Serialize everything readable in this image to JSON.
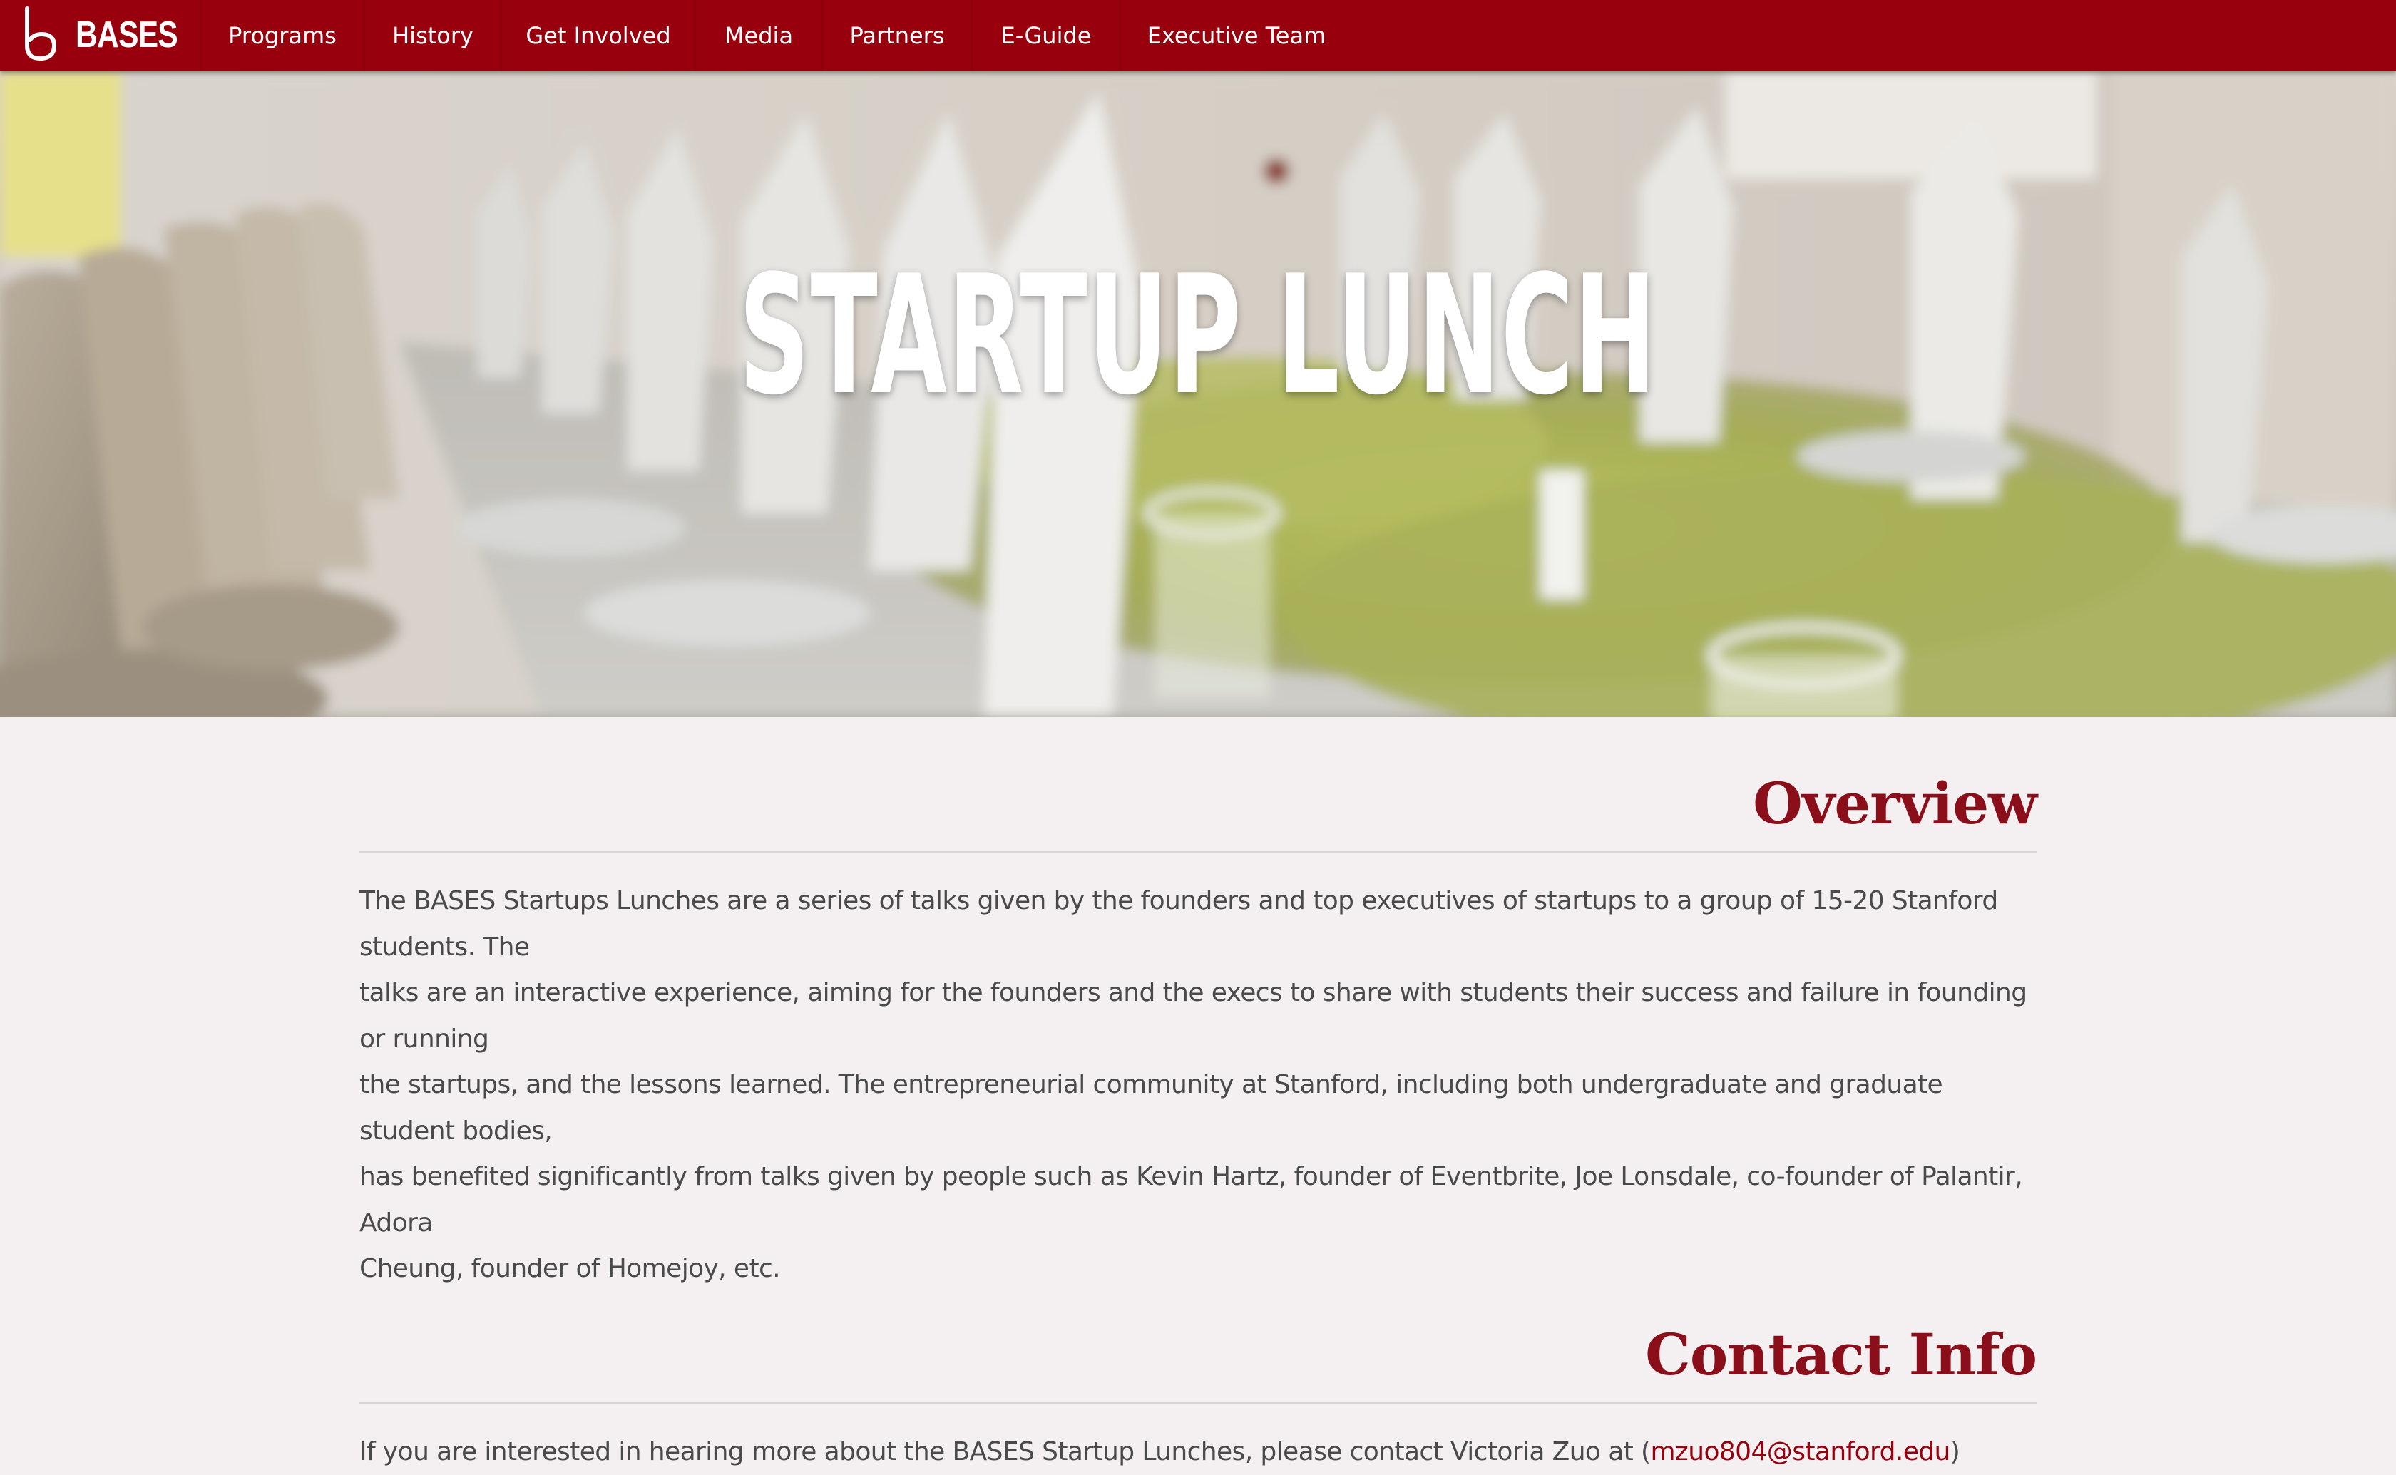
{
  "brand": {
    "name": "BASES",
    "logo_icon": "bases-logo-icon"
  },
  "nav": {
    "items": [
      {
        "label": "Programs"
      },
      {
        "label": "History"
      },
      {
        "label": "Get Involved"
      },
      {
        "label": "Media"
      },
      {
        "label": "Partners"
      },
      {
        "label": "E-Guide"
      },
      {
        "label": "Executive Team"
      }
    ]
  },
  "hero": {
    "title": "STARTUP LUNCH"
  },
  "overview": {
    "heading": "Overview",
    "lines": [
      "The BASES Startups Lunches are a series of talks given by the founders and top executives of startups to a group of 15-20 Stanford students. The",
      "talks are an interactive experience, aiming for the founders and the execs to share with students their success and failure in founding or running",
      "the startups, and the lessons learned. The entrepreneurial community at Stanford, including both undergraduate and graduate student bodies,",
      "has benefited significantly from talks given by people such as Kevin Hartz, founder of Eventbrite, Joe Lonsdale, co-founder of Palantir, Adora",
      "Cheung, founder of Homejoy, etc."
    ]
  },
  "contact": {
    "heading": "Contact Info",
    "text_before": "If you are interested in hearing more about the BASES Startup Lunches, please contact Victoria Zuo at (",
    "email": "mzuo804@stanford.edu",
    "text_after": ")"
  },
  "colors": {
    "primary": "#98000e",
    "heading": "#8b0f1a",
    "background": "#f4eff1",
    "body_text": "#4a4a4a"
  }
}
